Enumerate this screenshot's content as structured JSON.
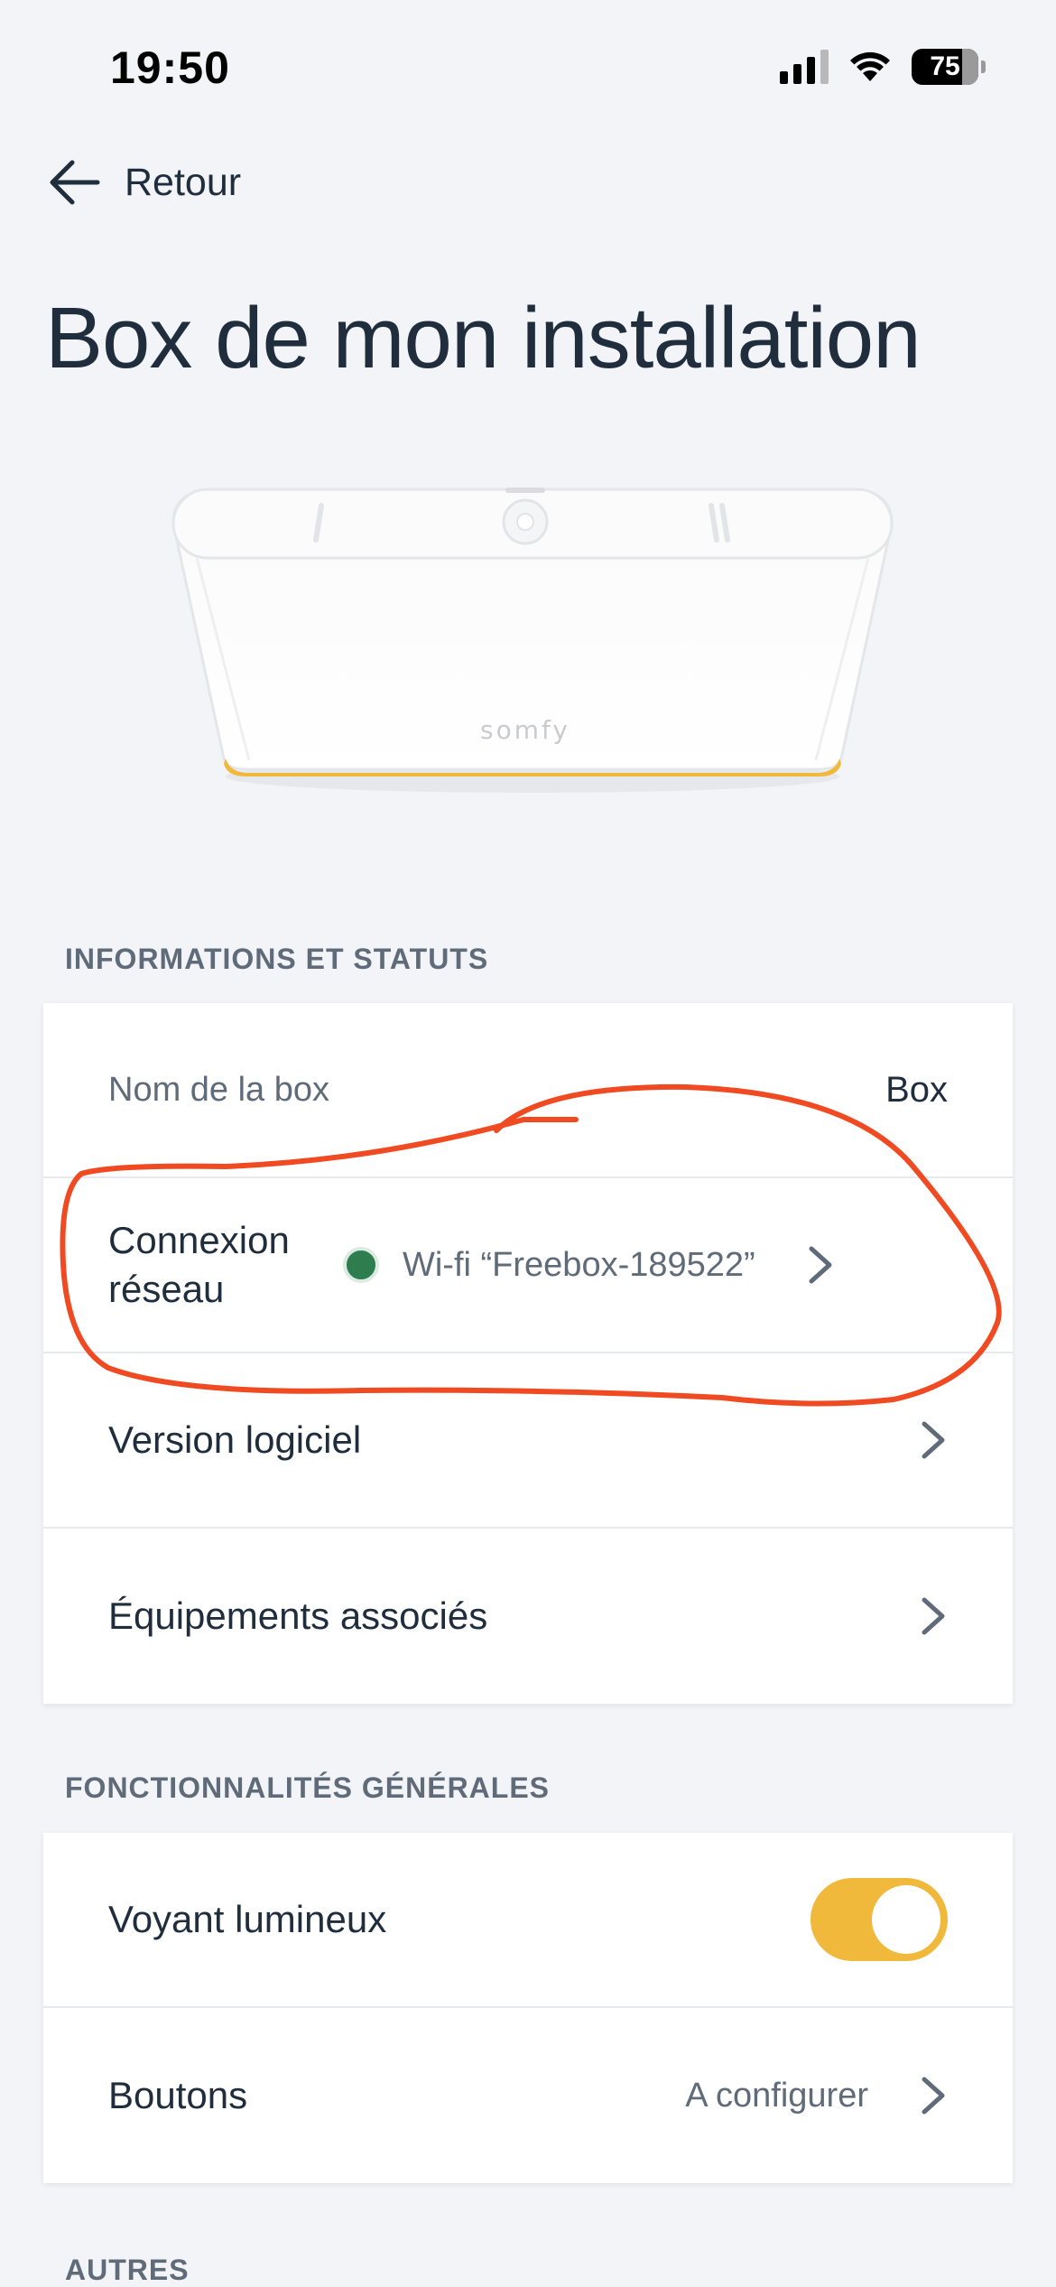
{
  "status_bar": {
    "time": "19:50",
    "battery": "75"
  },
  "nav": {
    "back_label": "Retour"
  },
  "page": {
    "title": "Box de mon installation"
  },
  "device": {
    "brand": "somfy"
  },
  "sections": {
    "info": {
      "header": "INFORMATIONS ET STATUTS",
      "rows": {
        "box_name": {
          "label": "Nom de la box",
          "value": "Box"
        },
        "network": {
          "label": "Connexion réseau",
          "status": "Wi-fi “Freebox-189522”",
          "status_color": "#2e7d4f"
        },
        "software": {
          "label": "Version logiciel"
        },
        "devices": {
          "label": "Équipements associés"
        }
      }
    },
    "features": {
      "header": "FONCTIONNALITÉS GÉNÉRALES",
      "rows": {
        "led": {
          "label": "Voyant lumineux",
          "enabled": true
        },
        "buttons": {
          "label": "Boutons",
          "value": "A configurer"
        }
      }
    },
    "other": {
      "header": "AUTRES"
    }
  },
  "colors": {
    "background": "#f2f4f7",
    "accent": "#f0b93c",
    "text": "#1f2d3d",
    "annotation": "#f04a23"
  }
}
